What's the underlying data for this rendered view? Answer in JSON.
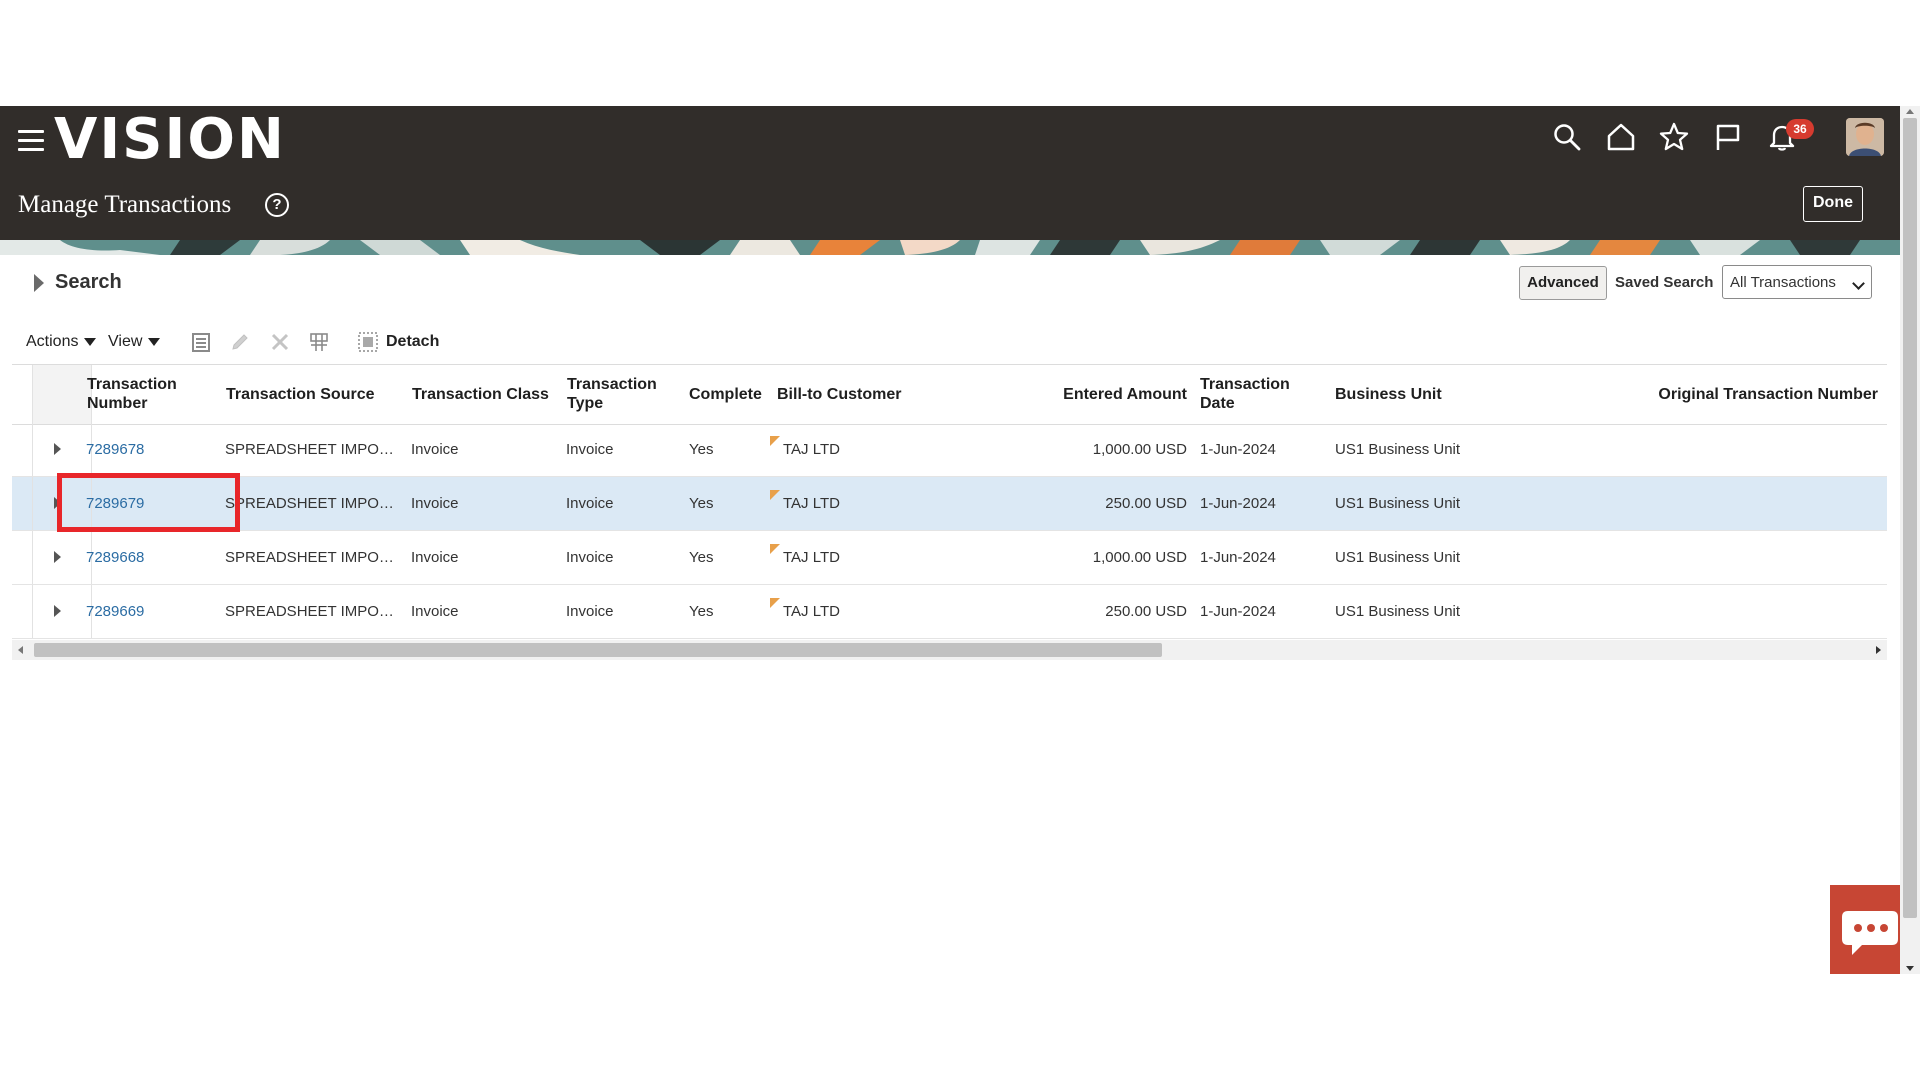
{
  "app": {
    "brand": "VISION",
    "page_title": "Manage Transactions",
    "help_glyph": "?"
  },
  "header": {
    "icons": [
      "search-icon",
      "home-icon",
      "star-icon",
      "flag-icon",
      "bell-icon"
    ],
    "notification_count": "36",
    "done_label": "Done"
  },
  "search": {
    "label": "Search",
    "advanced_label": "Advanced",
    "saved_search_label": "Saved Search",
    "saved_search_value": "All Transactions"
  },
  "toolbar": {
    "actions_label": "Actions",
    "view_label": "View",
    "detach_label": "Detach"
  },
  "table": {
    "columns": [
      {
        "line1": "Transaction",
        "line2": "Number"
      },
      {
        "line1": "Transaction Source",
        "line2": ""
      },
      {
        "line1": "Transaction Class",
        "line2": ""
      },
      {
        "line1": "Transaction",
        "line2": "Type"
      },
      {
        "line1": "Complete",
        "line2": ""
      },
      {
        "line1": "Bill-to Customer",
        "line2": ""
      },
      {
        "line1": "Entered Amount",
        "line2": ""
      },
      {
        "line1": "Transaction",
        "line2": "Date"
      },
      {
        "line1": "Business Unit",
        "line2": ""
      },
      {
        "line1": "Original Transaction Number",
        "line2": ""
      }
    ],
    "rows": [
      {
        "number": "7289678",
        "source": "SPREADSHEET IMPO…",
        "class": "Invoice",
        "type": "Invoice",
        "complete": "Yes",
        "customer": "TAJ LTD",
        "amount": "1,000.00 USD",
        "date": "1-Jun-2024",
        "bu": "US1 Business Unit"
      },
      {
        "number": "7289679",
        "source": "SPREADSHEET IMPO…",
        "class": "Invoice",
        "type": "Invoice",
        "complete": "Yes",
        "customer": "TAJ LTD",
        "amount": "250.00 USD",
        "date": "1-Jun-2024",
        "bu": "US1 Business Unit"
      },
      {
        "number": "7289668",
        "source": "SPREADSHEET IMPO…",
        "class": "Invoice",
        "type": "Invoice",
        "complete": "Yes",
        "customer": "TAJ LTD",
        "amount": "1,000.00 USD",
        "date": "1-Jun-2024",
        "bu": "US1 Business Unit"
      },
      {
        "number": "7289669",
        "source": "SPREADSHEET IMPO…",
        "class": "Invoice",
        "type": "Invoice",
        "complete": "Yes",
        "customer": "TAJ LTD",
        "amount": "250.00 USD",
        "date": "1-Jun-2024",
        "bu": "US1 Business Unit"
      }
    ],
    "selected_row": 1
  },
  "colors": {
    "header_bg": "#312d2a",
    "link": "#2b6ca3",
    "selected_row": "#dbe9f5",
    "highlight": "#e8262a",
    "chat": "#c74634",
    "badge": "#d63b2f"
  }
}
